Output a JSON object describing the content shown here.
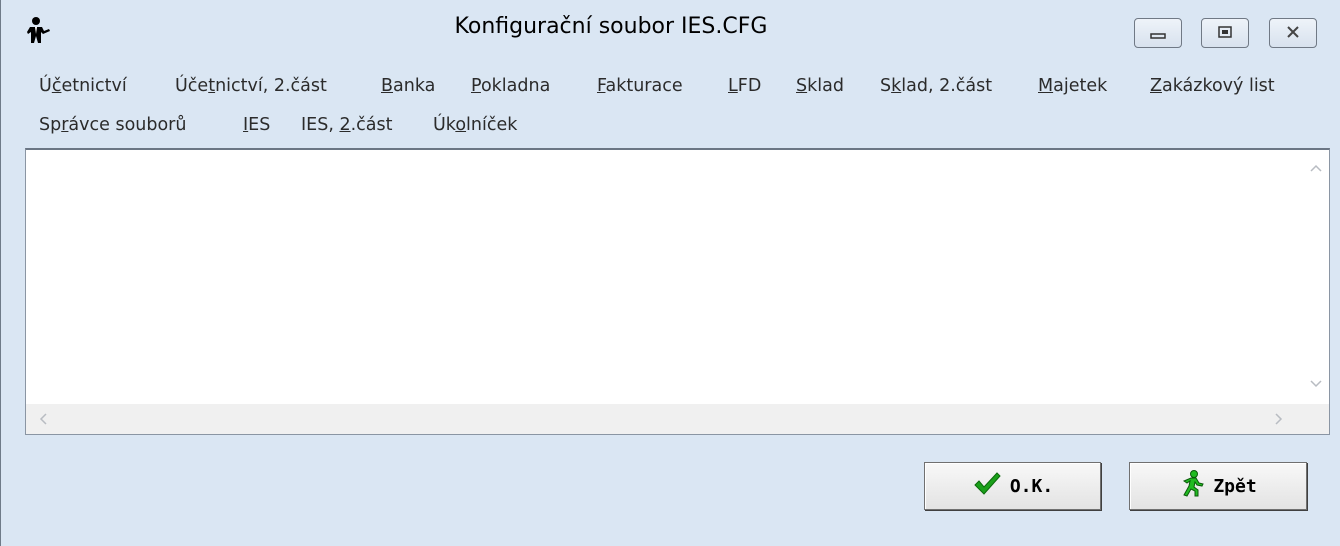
{
  "window": {
    "title": "Konfigurační soubor IES.CFG"
  },
  "icons": {
    "app": "user-icon",
    "minimize": "minimize-icon",
    "maximize": "maximize-icon",
    "close": "close-icon",
    "ok": "checkmark-icon",
    "back": "running-man-icon"
  },
  "menu": {
    "row1": [
      {
        "pre": "Ú",
        "key": "č",
        "post": "etnictví"
      },
      {
        "pre": "Úče",
        "key": "t",
        "post": "nictví, 2.část"
      },
      {
        "pre": "",
        "key": "B",
        "post": "anka"
      },
      {
        "pre": "",
        "key": "P",
        "post": "okladna"
      },
      {
        "pre": "",
        "key": "F",
        "post": "akturace"
      },
      {
        "pre": "",
        "key": "L",
        "post": "FD"
      },
      {
        "pre": "",
        "key": "S",
        "post": "klad"
      },
      {
        "pre": "S",
        "key": "k",
        "post": "lad, 2.část"
      },
      {
        "pre": "",
        "key": "M",
        "post": "ajetek"
      },
      {
        "pre": "",
        "key": "Z",
        "post": "akázkový list"
      }
    ],
    "row2": [
      {
        "pre": "Sp",
        "key": "r",
        "post": "ávce souborů"
      },
      {
        "pre": "",
        "key": "I",
        "post": "ES"
      },
      {
        "pre": "IES, ",
        "key": "2",
        "post": ".část"
      },
      {
        "pre": "Úk",
        "key": "o",
        "post": "lníček"
      }
    ]
  },
  "buttons": {
    "ok_label": "O.K.",
    "back_label": "Zpět"
  },
  "colors": {
    "window_bg": "#dae6f3",
    "ok_check": "#1aa01a",
    "back_icon": "#22bb22"
  }
}
